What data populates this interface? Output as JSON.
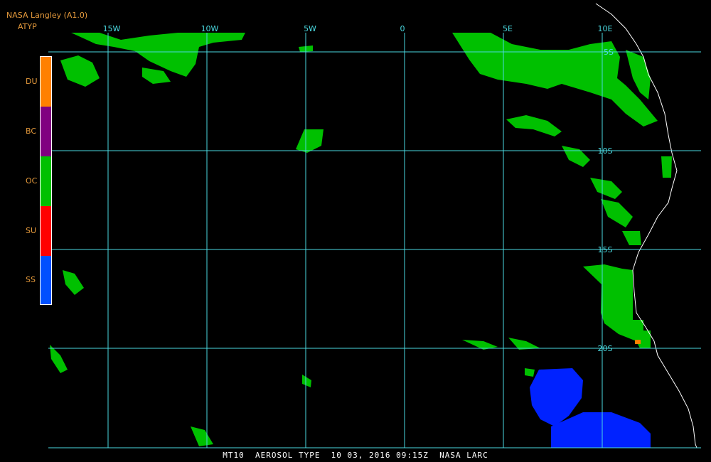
{
  "header": {
    "source": "NASA Langley (A1.0)",
    "product": "ATYP"
  },
  "legend": {
    "items": [
      {
        "label": "DU",
        "color": "#ff8000"
      },
      {
        "label": "BC",
        "color": "#800080"
      },
      {
        "label": "OC",
        "color": "#00c000"
      },
      {
        "label": "SU",
        "color": "#ff0000"
      },
      {
        "label": "SS",
        "color": "#0050ff"
      }
    ]
  },
  "grid": {
    "color": "#4ad9e0",
    "lon_labels": [
      "15W",
      "10W",
      "5W",
      "0",
      "5E",
      "10E"
    ],
    "lat_labels": [
      "5S",
      "10S",
      "15S",
      "20S"
    ]
  },
  "footer": {
    "caption": "MT10  AEROSOL TYPE  10 03, 2016 09:15Z  NASA LARC"
  },
  "colors": {
    "coastline": "#ffffff",
    "oc": "#00c000",
    "ss": "#0022ff",
    "du": "#ff8000"
  }
}
